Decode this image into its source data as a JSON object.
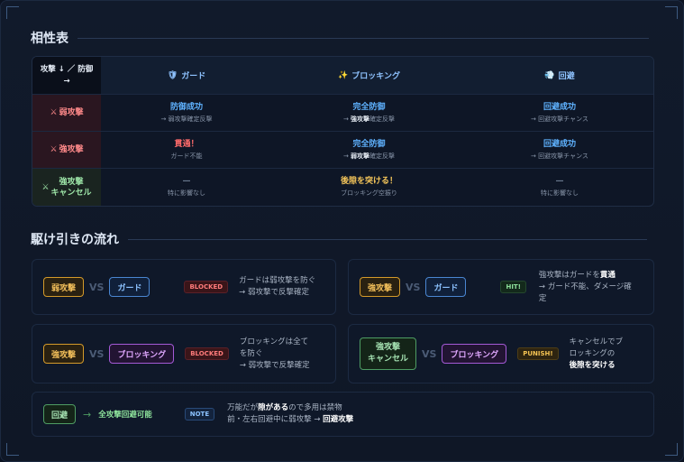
{
  "section1": {
    "title": "相性表"
  },
  "table": {
    "corner": {
      "line1": "攻撃 ↓ ／ 防御",
      "line2": "→"
    },
    "columns": [
      {
        "icon": "shield-icon",
        "glyph": "🛡",
        "label": "ガード"
      },
      {
        "icon": "sparkle-icon",
        "glyph": "✨",
        "label": "ブロッキング"
      },
      {
        "icon": "dash-icon",
        "glyph": "💨",
        "label": "回避"
      }
    ],
    "rows": [
      {
        "icon": "⚔",
        "label": "弱攻撃",
        "label2": "",
        "cells": [
          {
            "main": "防御成功",
            "sub": "→ 弱攻撃確定反撃",
            "sub_bold": "",
            "sub_rest": ""
          },
          {
            "main": "完全防御",
            "sub": "→ ",
            "sub_bold": "強攻撃",
            "sub_rest": "確定反撃"
          },
          {
            "main": "回避成功",
            "sub": "→ 回避攻撃チャンス",
            "sub_bold": "",
            "sub_rest": ""
          }
        ]
      },
      {
        "icon": "⚔",
        "label": "強攻撃",
        "label2": "",
        "cells": [
          {
            "main": "貫通！",
            "sub": "ガード不能",
            "sub_bold": "",
            "sub_rest": ""
          },
          {
            "main": "完全防御",
            "sub": "→ ",
            "sub_bold": "弱攻撃",
            "sub_rest": "確定反撃"
          },
          {
            "main": "回避成功",
            "sub": "→ 回避攻撃チャンス",
            "sub_bold": "",
            "sub_rest": ""
          }
        ]
      },
      {
        "icon": "⚔",
        "label": "強攻撃",
        "label2": "キャンセル",
        "cells": [
          {
            "main": "—",
            "sub": "特に影響なし",
            "sub_bold": "",
            "sub_rest": ""
          },
          {
            "main": "後隙を突ける！",
            "sub": "ブロッキング空振り",
            "sub_bold": "",
            "sub_rest": ""
          },
          {
            "main": "—",
            "sub": "特に影響なし",
            "sub_bold": "",
            "sub_rest": ""
          }
        ]
      }
    ]
  },
  "section2": {
    "title": "駆け引きの流れ"
  },
  "flows": [
    {
      "left": "弱攻撃",
      "vs": "VS",
      "right": "ガード",
      "badge": "BLOCKED",
      "desc1": "ガードは弱攻撃を防ぐ",
      "desc2": "→ 弱攻撃で反撃確定"
    },
    {
      "left": "強攻撃",
      "vs": "VS",
      "right": "ガード",
      "badge": "HIT!",
      "desc1_pre": "強攻撃はガードを",
      "desc1_bold": "貫通",
      "desc2": "→ ガード不能、ダメージ確",
      "desc3": "定"
    },
    {
      "left": "強攻撃",
      "vs": "VS",
      "right": "ブロッキング",
      "badge": "BLOCKED",
      "desc1": "ブロッキングは全て",
      "desc2": "を防ぐ",
      "desc3": "→ 弱攻撃で反撃確定"
    },
    {
      "left1": "強攻撃",
      "left2": "キャンセル",
      "vs": "VS",
      "right": "ブロッキング",
      "badge": "PUNISH!",
      "desc1": "キャンセルでブ",
      "desc2": "ロッキングの",
      "desc3": "後隙を突ける"
    },
    {
      "left": "回避",
      "arrow": "→",
      "result": "全攻撃回避可能",
      "badge": "NOTE",
      "desc1_pre": "万能だが",
      "desc1_bold": "隙がある",
      "desc1_rest": "ので多用は禁物",
      "desc2_pre": "前・左右回避中に弱攻撃 → ",
      "desc2_bold": "回避攻撃"
    }
  ]
}
